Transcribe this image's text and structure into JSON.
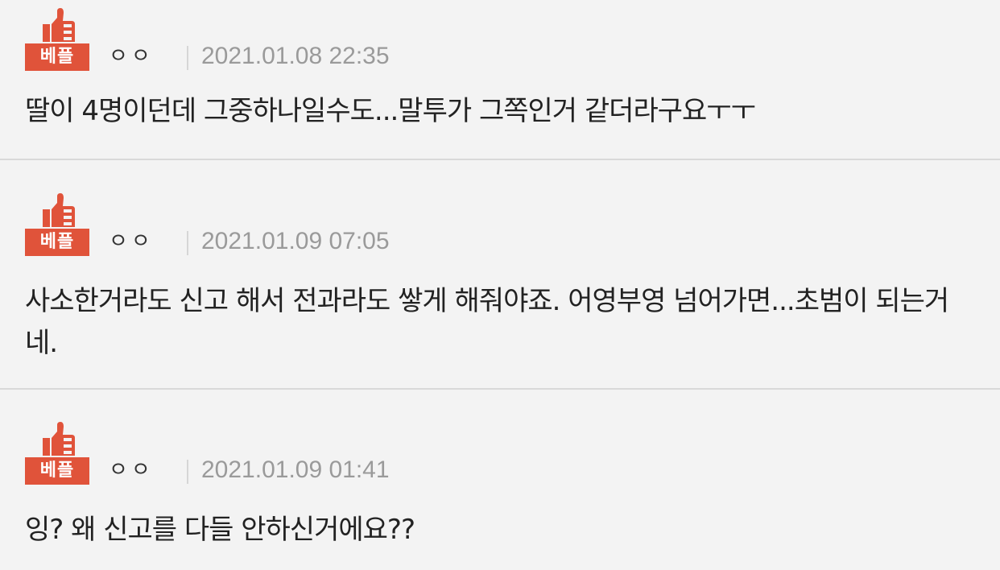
{
  "comments": [
    {
      "badge": "베플",
      "author": "ㅇㅇ",
      "date": "2021.01.08 22:35",
      "text": "딸이 4명이던데 그중하나일수도...말투가 그쪽인거 같더라구요ㅜㅜ"
    },
    {
      "badge": "베플",
      "author": "ㅇㅇ",
      "date": "2021.01.09 07:05",
      "text": "사소한거라도 신고 해서 전과라도 쌓게 해줘야죠. 어영부영 넘어가면...초범이 되는거네."
    },
    {
      "badge": "베플",
      "author": "ㅇㅇ",
      "date": "2021.01.09 01:41",
      "text": "잉? 왜 신고를 다들 안하신거에요??"
    }
  ],
  "colors": {
    "badge": "#e0533a",
    "background": "#f3f3f3",
    "divider": "#d9d9d9",
    "date": "#9a9a9a"
  },
  "icons": {
    "badge_icon": "thumbs-up-icon"
  }
}
